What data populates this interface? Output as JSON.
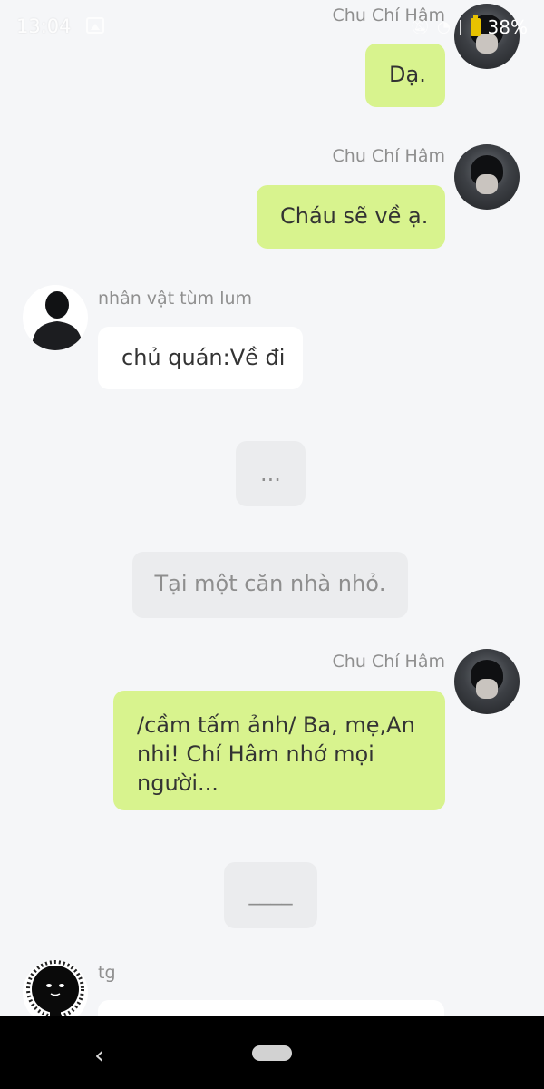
{
  "status_bar": {
    "time": "13:04",
    "battery": "38%",
    "icons": [
      "gallery-icon",
      "mute-icon",
      "wifi-icon",
      "signal-icon",
      "battery-icon"
    ]
  },
  "messages": [
    {
      "speaker": "Chu Chí Hâm",
      "side": "right",
      "text": "Dạ."
    },
    {
      "speaker": "Chu Chí Hâm",
      "side": "right",
      "text": "Cháu sẽ về ạ."
    },
    {
      "speaker": "nhân vật tùm lum",
      "side": "left",
      "text": "chủ quán:Về đi"
    },
    {
      "type": "narration",
      "text": "..."
    },
    {
      "type": "narration",
      "text": "Tại một căn nhà nhỏ."
    },
    {
      "speaker": "Chu Chí Hâm",
      "side": "right",
      "text": "/cầm tấm ảnh/ Ba, mẹ,An nhi! Chí Hâm nhớ mọi người..."
    },
    {
      "type": "narration",
      "text": "____"
    },
    {
      "speaker": "tg",
      "side": "left",
      "text": ""
    }
  ],
  "colors": {
    "background": "#f5f6f8",
    "bubble_green": "#d8f38e",
    "bubble_white": "#ffffff",
    "bubble_gray": "#ebecee",
    "name_text": "#8f8f8f",
    "nav_bar": "#000000"
  }
}
